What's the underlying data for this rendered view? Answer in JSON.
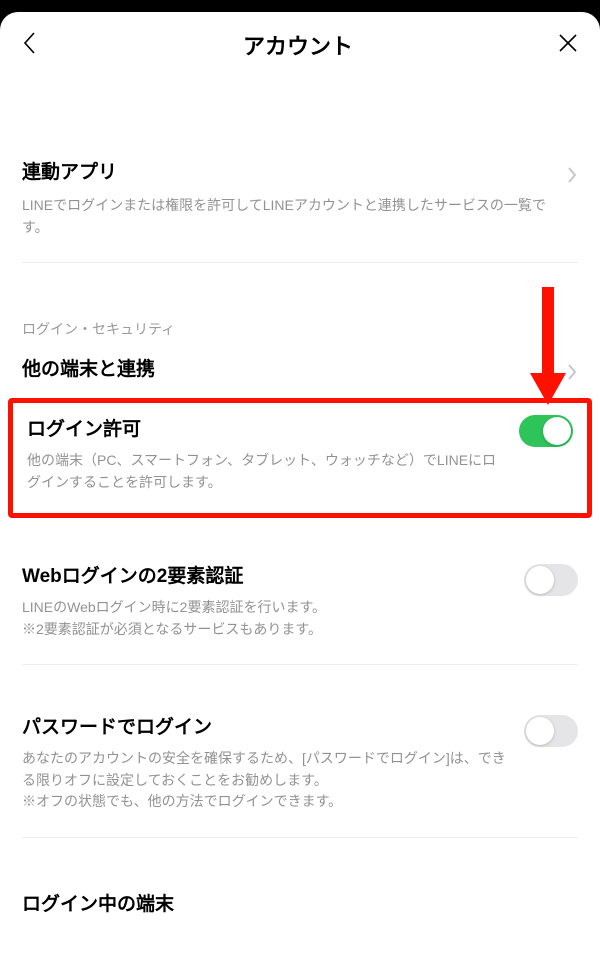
{
  "header": {
    "title": "アカウント"
  },
  "linkedApps": {
    "title": "連動アプリ",
    "desc": "LINEでログインまたは権限を許可してLINEアカウントと連携したサービスの一覧です。"
  },
  "sectionLabel": "ログイン・セキュリティ",
  "otherDevices": {
    "title": "他の端末と連携"
  },
  "loginAllow": {
    "title": "ログイン許可",
    "desc": "他の端末（PC、スマートフォン、タブレット、ウォッチなど）でLINEにログインすることを許可します。",
    "on": true
  },
  "twoFactor": {
    "title": "Webログインの2要素認証",
    "desc1": "LINEのWebログイン時に2要素認証を行います。",
    "desc2": "※2要素認証が必須となるサービスもあります。",
    "on": false
  },
  "passwordLogin": {
    "title": "パスワードでログイン",
    "desc1": "あなたのアカウントの安全を確保するため、[パスワードでログイン]は、できる限りオフに設定しておくことをお勧めします。",
    "desc2": "※オフの状態でも、他の方法でログインできます。",
    "on": false
  },
  "loggedIn": {
    "title": "ログイン中の端末"
  }
}
